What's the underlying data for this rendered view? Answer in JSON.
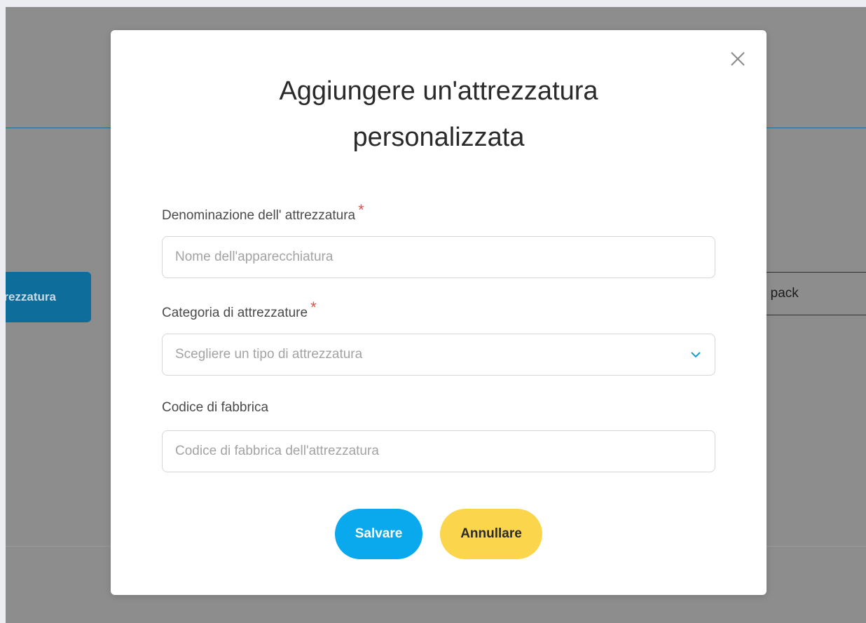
{
  "background": {
    "add_button_label": "ttrezzatura",
    "pack_button_label": "del pack"
  },
  "modal": {
    "title_line1": "Aggiungere un'attrezzatura",
    "title_line2": "personalizzata",
    "fields": {
      "name": {
        "label": "Denominazione dell' attrezzatura",
        "required_mark": "*",
        "placeholder": "Nome dell'apparecchiatura",
        "value": ""
      },
      "category": {
        "label": "Categoria di attrezzature",
        "required_mark": "*",
        "placeholder": "Scegliere un tipo di attrezzatura"
      },
      "factory_code": {
        "label": "Codice di fabbrica",
        "placeholder": "Codice di fabbrica dell'attrezzatura",
        "value": ""
      }
    },
    "buttons": {
      "save_label": "Salvare",
      "cancel_label": "Annullare"
    }
  },
  "icons": {
    "close": "close-icon",
    "dropdown": "chevron-down-icon"
  },
  "colors": {
    "save_button": "#0aa8ec",
    "cancel_button": "#fbd54b",
    "required_mark": "#d9534f",
    "chevron": "#1a9ad6",
    "overlay": "#8d8d8d"
  }
}
